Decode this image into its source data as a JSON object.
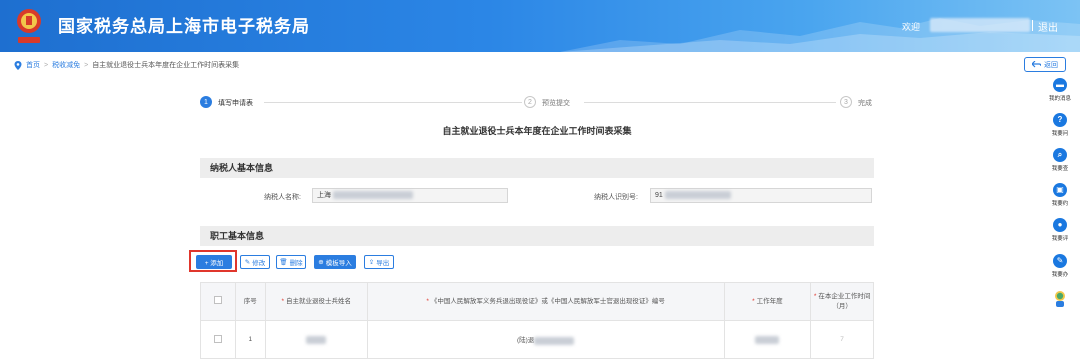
{
  "header": {
    "title": "国家税务总局上海市电子税务局",
    "welcome": "欢迎",
    "logout": "退出"
  },
  "breadcrumb": {
    "home": "首页",
    "level1": "税收减免",
    "current": "自主就业退役士兵本年度在企业工作时间表采集"
  },
  "back_button": "返回",
  "steps": [
    {
      "num": "1",
      "label": "填写申请表"
    },
    {
      "num": "2",
      "label": "预览提交"
    },
    {
      "num": "3",
      "label": "完成"
    }
  ],
  "form_title": "自主就业退役士兵本年度在企业工作时间表采集",
  "taxpayer": {
    "section_title": "纳税人基本信息",
    "name_label": "纳税人名称:",
    "name_value": "上海",
    "id_label": "纳税人识别号:",
    "id_value": "91"
  },
  "employee": {
    "section_title": "职工基本信息"
  },
  "toolbar": {
    "add": "+ 添加",
    "edit": "修改",
    "delete": "删除",
    "template_import": "模板导入",
    "export": "导出"
  },
  "table": {
    "headers": {
      "seq": "序号",
      "name": "自主就业退役士兵姓名",
      "cert": "《中国人民解放军义务兵退出现役证》或《中国人民解放军士官退出现役证》编号",
      "year": "工作年度",
      "months": "在本企业工作时间（月）"
    },
    "rows": [
      {
        "seq": "1",
        "cert_prefix": "(陆)退",
        "months": "7"
      }
    ]
  },
  "sidebar": [
    {
      "icon": "message-icon",
      "label": "我的消息"
    },
    {
      "icon": "question-icon",
      "label": "我要问"
    },
    {
      "icon": "search-icon",
      "label": "我要查"
    },
    {
      "icon": "calendar-icon",
      "label": "我要约"
    },
    {
      "icon": "comment-icon",
      "label": "我要评"
    },
    {
      "icon": "edit-icon",
      "label": "我要办"
    },
    {
      "icon": "mascot-icon",
      "label": ""
    }
  ],
  "colors": {
    "primary": "#2b7de0",
    "highlight": "#e0362c",
    "header_start": "#1e6fd0",
    "header_end": "#7cc3f4"
  }
}
